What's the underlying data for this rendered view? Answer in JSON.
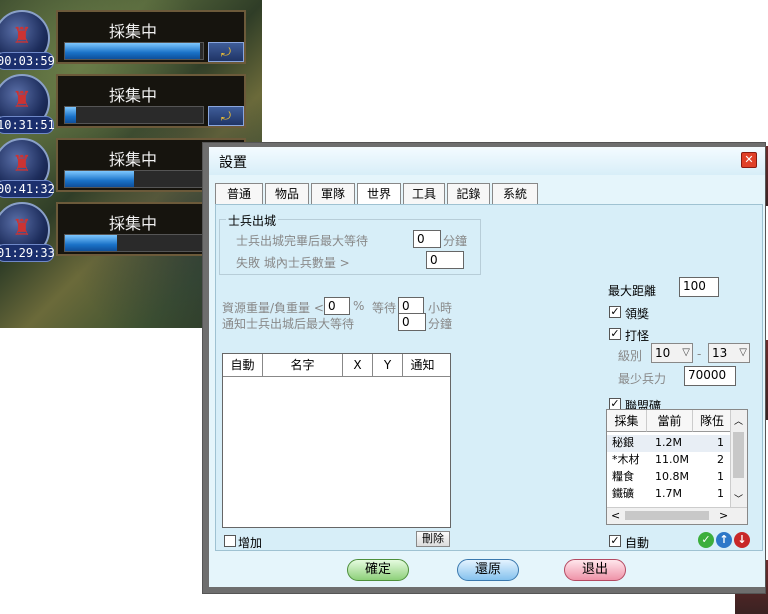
{
  "gather_tasks": [
    {
      "label": "採集中",
      "timer": "00:03:59",
      "progress": 0.98,
      "has_speed_button": true
    },
    {
      "label": "採集中",
      "timer": "10:31:51",
      "progress": 0.08,
      "has_speed_button": true
    },
    {
      "label": "採集中",
      "timer": "00:41:32",
      "progress": 0.5,
      "has_speed_button": false
    },
    {
      "label": "採集中",
      "timer": "01:29:33",
      "progress": 0.38,
      "has_speed_button": false
    }
  ],
  "dialog": {
    "title": "設置",
    "close_icon": "close-icon",
    "tabs": [
      {
        "label": "普通",
        "active": false
      },
      {
        "label": "物品",
        "active": false
      },
      {
        "label": "軍隊",
        "active": false
      },
      {
        "label": "世界",
        "active": true
      },
      {
        "label": "工具",
        "active": false
      },
      {
        "label": "記錄",
        "active": false
      },
      {
        "label": "系統",
        "active": false
      }
    ],
    "soldier_section": {
      "legend": "士兵出城",
      "max_wait_label": "士兵出城完畢后最大等待",
      "max_wait_value": "0",
      "max_wait_unit": "分鐘",
      "fail_label": "失敗 城內士兵數量 >",
      "fail_value": "0"
    },
    "resource": {
      "ratio_label": "資源重量/負重量 <",
      "ratio_value": "0",
      "ratio_unit": "%",
      "wait_label": "等待",
      "wait_value": "0",
      "wait_unit": "小時",
      "notify_label": "通知士兵出城后最大等待",
      "notify_value": "0",
      "notify_unit": "分鐘"
    },
    "list": {
      "columns": [
        "自動",
        "名字",
        "X",
        "Y",
        "通知"
      ],
      "add_label": "增加",
      "delete_label": "刪除"
    },
    "world": {
      "max_distance_label": "最大距離",
      "max_distance_value": "100",
      "claim_reward_label": "領獎",
      "claim_reward_checked": true,
      "fight_monster_label": "打怪",
      "fight_monster_checked": true,
      "level_label": "級別",
      "level_from": "10",
      "level_sep": "-",
      "level_to": "13",
      "min_power_label": "最少兵力",
      "min_power_value": "70000",
      "alliance_mine_label": "聯盟礦",
      "alliance_mine_checked": true,
      "auto_label": "自動",
      "auto_checked": true
    },
    "resource_table": {
      "columns": [
        "採集",
        "當前",
        "隊伍"
      ],
      "rows": [
        [
          "秘銀",
          "1.2M",
          "1"
        ],
        [
          "*木材",
          "11.0M",
          "2"
        ],
        [
          "糧食",
          "10.8M",
          "1"
        ],
        [
          "鐵礦",
          "1.7M",
          "1"
        ]
      ]
    },
    "footer": {
      "ok_label": "確定",
      "restore_label": "還原",
      "exit_label": "退出"
    }
  }
}
